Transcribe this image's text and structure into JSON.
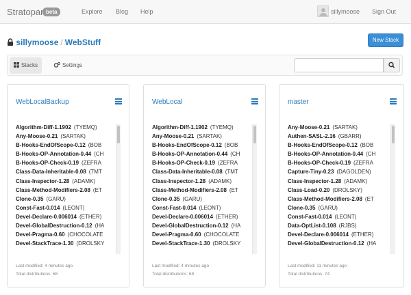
{
  "navbar": {
    "brand": "Stratopan",
    "badge": "beta",
    "links": [
      "Explore",
      "Blog",
      "Help"
    ],
    "username": "sillymoose",
    "signout": "Sign Out"
  },
  "breadcrumb": {
    "user": "sillymoose",
    "separator": "/",
    "repo": "WebStuff"
  },
  "actions": {
    "new_stack": "New Stack"
  },
  "tabs": {
    "stacks": "Stacks",
    "settings": "Settings"
  },
  "search": {
    "value": "",
    "placeholder": ""
  },
  "panels": [
    {
      "title": "WebLocalBackup",
      "items": [
        {
          "dist": "Algorithm-Diff-1.1902",
          "author": "(TYEMQ)"
        },
        {
          "dist": "Any-Moose-0.21",
          "author": "(SARTAK)"
        },
        {
          "dist": "B-Hooks-EndOfScope-0.12",
          "author": "(BOB"
        },
        {
          "dist": "B-Hooks-OP-Annotation-0.44",
          "author": "(CH"
        },
        {
          "dist": "B-Hooks-OP-Check-0.19",
          "author": "(ZEFRA"
        },
        {
          "dist": "Class-Data-Inheritable-0.08",
          "author": "(TMT"
        },
        {
          "dist": "Class-Inspector-1.28",
          "author": "(ADAMK)"
        },
        {
          "dist": "Class-Method-Modifiers-2.08",
          "author": "(ET"
        },
        {
          "dist": "Clone-0.35",
          "author": "(GARU)"
        },
        {
          "dist": "Const-Fast-0.014",
          "author": "(LEONT)"
        },
        {
          "dist": "Devel-Declare-0.006014",
          "author": "(ETHER)"
        },
        {
          "dist": "Devel-GlobalDestruction-0.12",
          "author": "(HA"
        },
        {
          "dist": "Devel-Pragma-0.60",
          "author": "(CHOCOLATE"
        },
        {
          "dist": "Devel-StackTrace-1.30",
          "author": "(DROLSKY"
        }
      ],
      "last_modified": "Last modified: 4 minutes ago",
      "total": "Total distributions: 68"
    },
    {
      "title": "WebLocal",
      "items": [
        {
          "dist": "Algorithm-Diff-1.1902",
          "author": "(TYEMQ)"
        },
        {
          "dist": "Any-Moose-0.21",
          "author": "(SARTAK)"
        },
        {
          "dist": "B-Hooks-EndOfScope-0.12",
          "author": "(BOB"
        },
        {
          "dist": "B-Hooks-OP-Annotation-0.44",
          "author": "(CH"
        },
        {
          "dist": "B-Hooks-OP-Check-0.19",
          "author": "(ZEFRA"
        },
        {
          "dist": "Class-Data-Inheritable-0.08",
          "author": "(TMT"
        },
        {
          "dist": "Class-Inspector-1.28",
          "author": "(ADAMK)"
        },
        {
          "dist": "Class-Method-Modifiers-2.08",
          "author": "(ET"
        },
        {
          "dist": "Clone-0.35",
          "author": "(GARU)"
        },
        {
          "dist": "Const-Fast-0.014",
          "author": "(LEONT)"
        },
        {
          "dist": "Devel-Declare-0.006014",
          "author": "(ETHER)"
        },
        {
          "dist": "Devel-GlobalDestruction-0.12",
          "author": "(HA"
        },
        {
          "dist": "Devel-Pragma-0.60",
          "author": "(CHOCOLATE"
        },
        {
          "dist": "Devel-StackTrace-1.30",
          "author": "(DROLSKY"
        }
      ],
      "last_modified": "Last modified: 4 minutes ago",
      "total": "Total distributions: 68"
    },
    {
      "title": "master",
      "items": [
        {
          "dist": "Any-Moose-0.21",
          "author": "(SARTAK)"
        },
        {
          "dist": "Authen-SASL-2.16",
          "author": "(GBARR)"
        },
        {
          "dist": "B-Hooks-EndOfScope-0.12",
          "author": "(BOB"
        },
        {
          "dist": "B-Hooks-OP-Annotation-0.44",
          "author": "(CH"
        },
        {
          "dist": "B-Hooks-OP-Check-0.19",
          "author": "(ZEFRA"
        },
        {
          "dist": "Capture-Tiny-0.23",
          "author": "(DAGOLDEN)"
        },
        {
          "dist": "Class-Inspector-1.28",
          "author": "(ADAMK)"
        },
        {
          "dist": "Class-Load-0.20",
          "author": "(DROLSKY)"
        },
        {
          "dist": "Class-Method-Modifiers-2.08",
          "author": "(ET"
        },
        {
          "dist": "Clone-0.35",
          "author": "(GARU)"
        },
        {
          "dist": "Const-Fast-0.014",
          "author": "(LEONT)"
        },
        {
          "dist": "Data-OptList-0.108",
          "author": "(RJBS)"
        },
        {
          "dist": "Devel-Declare-0.006014",
          "author": "(ETHER)"
        },
        {
          "dist": "Devel-GlobalDestruction-0.12",
          "author": "(HA"
        }
      ],
      "last_modified": "Last modified: 11 minutes ago",
      "total": "Total distributions: 74"
    }
  ],
  "colors": {
    "link": "#2a7ab9",
    "primary_button": "#3a8fd6",
    "navbar_bg": "#f7f7f7"
  },
  "icons": {
    "lock": "lock-icon",
    "stacks": "th-large-icon",
    "settings": "cogs-icon",
    "search": "search-icon",
    "panel_menu": "hamburger-menu-icon"
  }
}
